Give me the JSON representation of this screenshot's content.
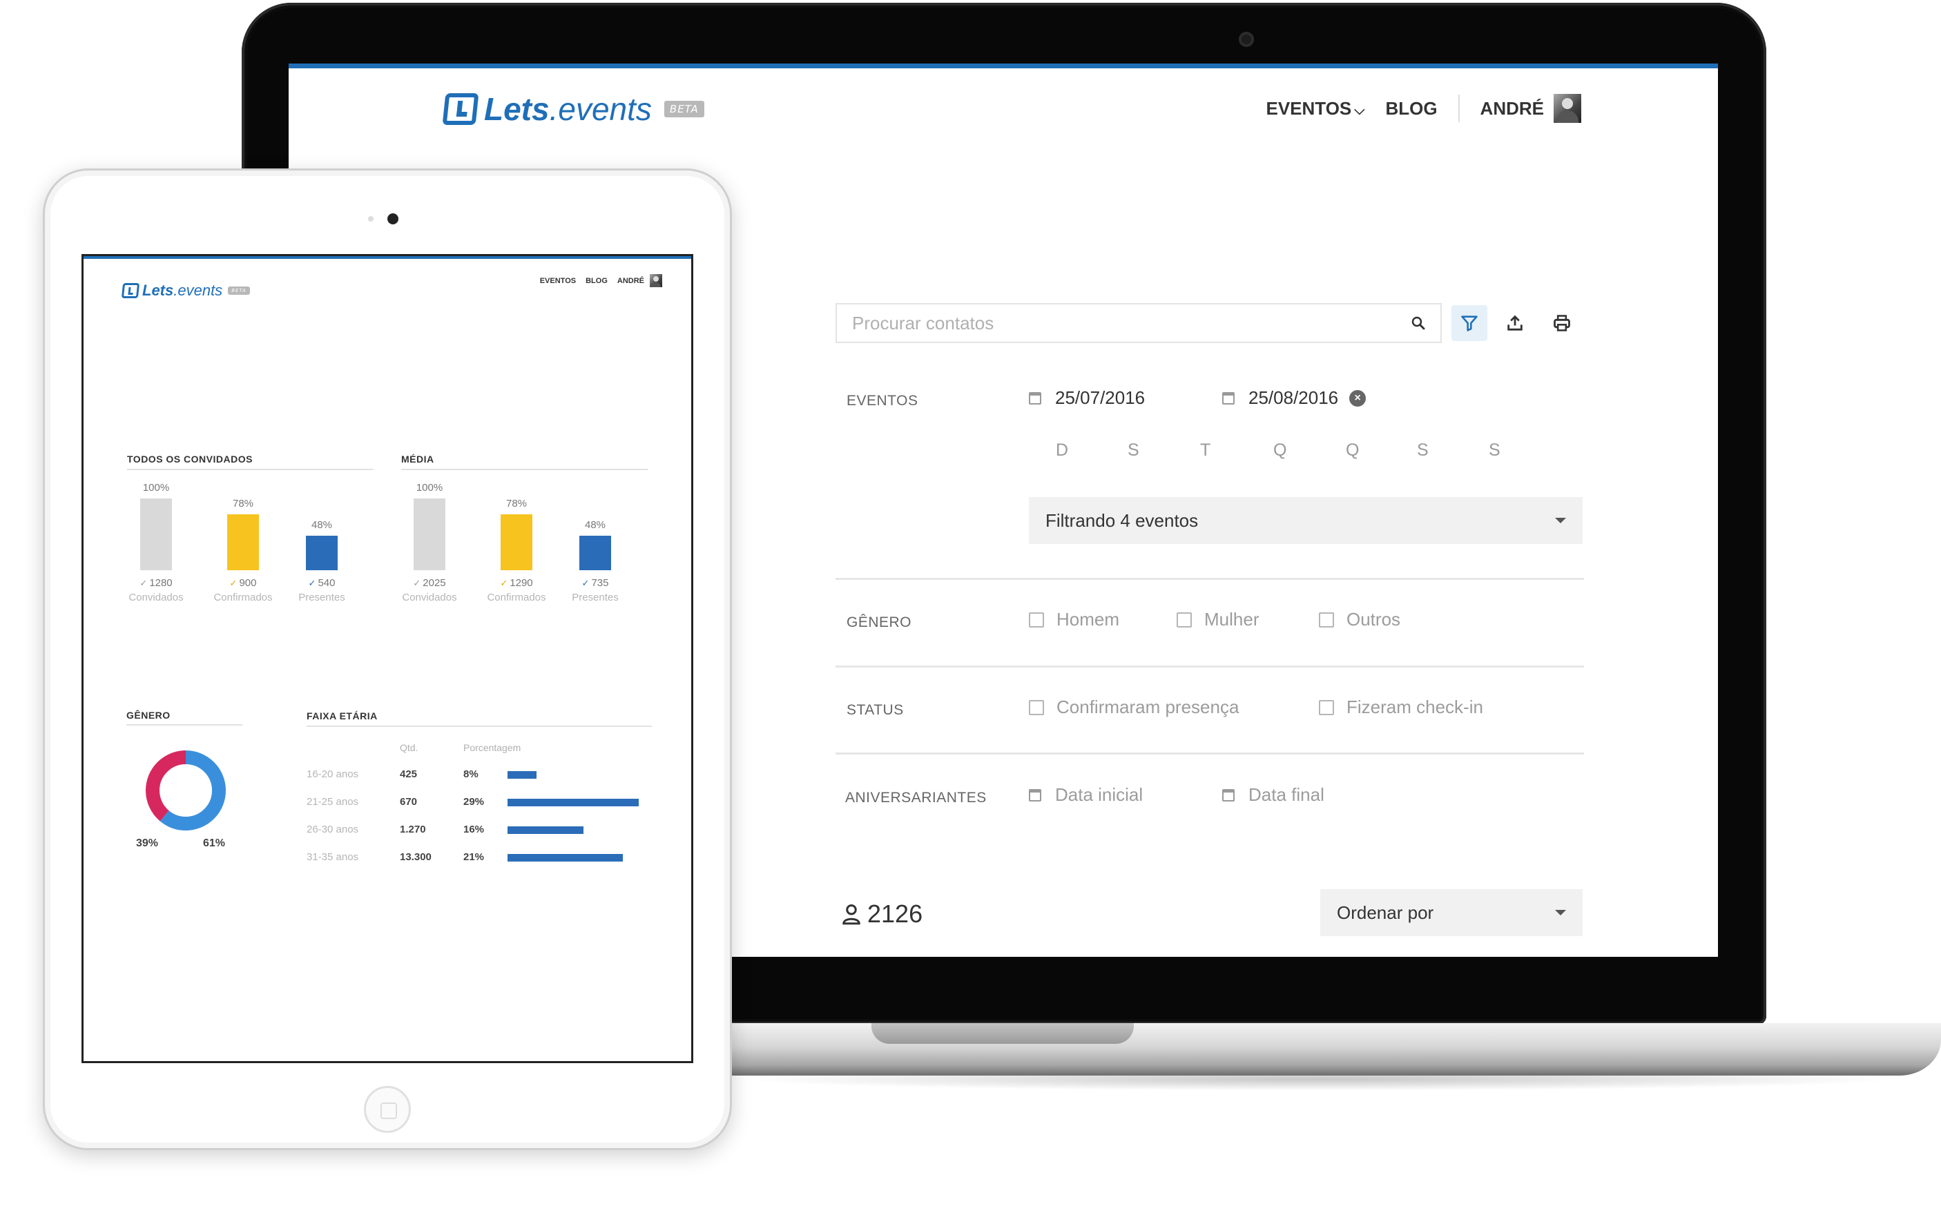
{
  "app": {
    "logo_bold": "Lets",
    "logo_rest": ".events",
    "beta": "BETA"
  },
  "nav": {
    "eventos": "EVENTOS",
    "blog": "BLOG",
    "user": "ANDRÉ"
  },
  "search": {
    "placeholder": "Procurar contatos"
  },
  "filters": {
    "eventos_label": "EVENTOS",
    "date_start": "25/07/2016",
    "date_end": "25/08/2016",
    "weekdays": [
      "D",
      "S",
      "T",
      "Q",
      "Q",
      "S",
      "S"
    ],
    "eventos_select": "Filtrando 4 eventos",
    "genero_label": "GÊNERO",
    "genero_options": [
      "Homem",
      "Mulher",
      "Outros"
    ],
    "status_label": "STATUS",
    "status_options": [
      "Confirmaram presença",
      "Fizeram check-in"
    ],
    "aniversariantes_label": "ANIVERSARIANTES",
    "birthday_start": "Data inicial",
    "birthday_end": "Data final"
  },
  "results": {
    "count": "2126",
    "sort": "Ordenar por"
  },
  "colors": {
    "accent": "#1f6fb8",
    "gray_bar": "#d9d9d9",
    "yellow_bar": "#f7c41f",
    "blue_bar": "#2b6cb8",
    "donut_blue": "#3a8fdc",
    "donut_red": "#d6285e"
  },
  "tablet": {
    "todos": {
      "title": "TODOS OS CONVIDADOS",
      "bars": [
        {
          "pct": "100%",
          "value": "1280",
          "label": "Convidados",
          "fraction": 1.0
        },
        {
          "pct": "78%",
          "value": "900",
          "label": "Confirmados",
          "fraction": 0.78
        },
        {
          "pct": "48%",
          "value": "540",
          "label": "Presentes",
          "fraction": 0.48
        }
      ]
    },
    "media": {
      "title": "MÉDIA",
      "bars": [
        {
          "pct": "100%",
          "value": "2025",
          "label": "Convidados",
          "fraction": 1.0
        },
        {
          "pct": "78%",
          "value": "1290",
          "label": "Confirmados",
          "fraction": 0.78
        },
        {
          "pct": "48%",
          "value": "735",
          "label": "Presentes",
          "fraction": 0.48
        }
      ]
    },
    "genero": {
      "title": "GÊNERO",
      "left_pct": "39%",
      "right_pct": "61%",
      "share_red": 0.39,
      "share_blue": 0.61
    },
    "faixa": {
      "title": "FAIXA ETÁRIA",
      "col_qtd": "Qtd.",
      "col_pct": "Porcentagem",
      "rows": [
        {
          "label": "16-20 anos",
          "qty": "425",
          "pct": "8%",
          "bar": 0.22
        },
        {
          "label": "21-25 anos",
          "qty": "670",
          "pct": "29%",
          "bar": 1.0
        },
        {
          "label": "26-30 anos",
          "qty": "1.270",
          "pct": "16%",
          "bar": 0.58
        },
        {
          "label": "31-35 anos",
          "qty": "13.300",
          "pct": "21%",
          "bar": 0.88
        }
      ]
    }
  }
}
